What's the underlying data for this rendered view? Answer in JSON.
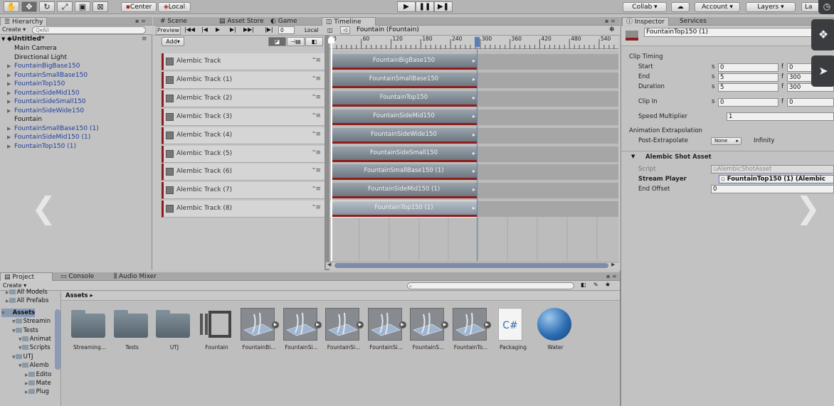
{
  "toolbar": {
    "tools": [
      "hand-tool-icon",
      "move-tool-icon",
      "rotate-tool-icon",
      "scale-tool-icon",
      "rect-tool-icon",
      "transform-tool-icon"
    ],
    "pivot_label": "Center",
    "space_label": "Local",
    "collab_label": "Collab ▾",
    "account_label": "Account",
    "layers_label": "Layers",
    "layout_label": "La"
  },
  "hierarchy": {
    "tab_label": "Hierarchy",
    "create_label": "Create ▾",
    "search_placeholder": "Q▾All",
    "scene_name": "Untitled*",
    "items": [
      {
        "label": "Main Camera",
        "prefab": false,
        "arrow": ""
      },
      {
        "label": "Directional Light",
        "prefab": false,
        "arrow": ""
      },
      {
        "label": "FountainBigBase150",
        "prefab": true,
        "arrow": "▶"
      },
      {
        "label": "FountainSmallBase150",
        "prefab": true,
        "arrow": "▶"
      },
      {
        "label": "FountainTop150",
        "prefab": true,
        "arrow": "▶"
      },
      {
        "label": "FountainSideMid150",
        "prefab": true,
        "arrow": "▶"
      },
      {
        "label": "FountainSideSmall150",
        "prefab": true,
        "arrow": "▶"
      },
      {
        "label": "FountainSideWide150",
        "prefab": true,
        "arrow": "▶"
      },
      {
        "label": "Fountain",
        "prefab": false,
        "arrow": ""
      },
      {
        "label": "FountainSmallBase150 (1)",
        "prefab": true,
        "arrow": "▶"
      },
      {
        "label": "FountainSideMid150 (1)",
        "prefab": true,
        "arrow": "▶"
      },
      {
        "label": "FountainTop150 (1)",
        "prefab": true,
        "arrow": "▶"
      }
    ]
  },
  "center_tabs": [
    "Scene",
    "Asset Store",
    "Game",
    "Timeline"
  ],
  "timeline": {
    "preview_label": "Preview",
    "frame_value": "0",
    "local_label": "Local",
    "title": "Fountain (Fountain)",
    "add_label": "Add▾",
    "ruler": [
      "0",
      "60",
      "120",
      "180",
      "240",
      "300",
      "360",
      "420",
      "480",
      "540"
    ],
    "tracks": [
      {
        "label": "Alembic Track",
        "clip": "FountainBigBase150"
      },
      {
        "label": "Alembic Track (1)",
        "clip": "FountainSmallBase150"
      },
      {
        "label": "Alembic Track (2)",
        "clip": "FountainTop150"
      },
      {
        "label": "Alembic Track (3)",
        "clip": "FountainSideMid150"
      },
      {
        "label": "Alembic Track (4)",
        "clip": "FountainSideWide150"
      },
      {
        "label": "Alembic Track (5)",
        "clip": "FountainSideSmall150"
      },
      {
        "label": "Alembic Track (6)",
        "clip": "FountainSmallBase150 (1)"
      },
      {
        "label": "Alembic Track (7)",
        "clip": "FountainSideMid150 (1)"
      },
      {
        "label": "Alembic Track (8)",
        "clip": "FountainTop150 (1)"
      }
    ]
  },
  "inspector": {
    "tab_label": "Inspector",
    "services_label": "Services",
    "object_name": "FountainTop150 (1)",
    "clip_timing_label": "Clip Timing",
    "rows": [
      {
        "label": "Start",
        "s": "0",
        "f": "0"
      },
      {
        "label": "End",
        "s": "5",
        "f": "300"
      },
      {
        "label": "Duration",
        "s": "5",
        "f": "300"
      },
      {
        "label": "Clip In",
        "s": "0",
        "f": "0"
      }
    ],
    "s_prefix": "s",
    "f_prefix": "f",
    "speed_label": "Speed Multiplier",
    "speed_value": "1",
    "extrap_label": "Animation Extrapolation",
    "post_label": "Post-Extrapolate",
    "post_value": "None",
    "post_extra": "Infinity",
    "component_label": "Alembic Shot Asset",
    "script_label": "Script",
    "script_value": "AlembicShotAsset",
    "stream_label": "Stream Player",
    "stream_value": "FountainTop150 (1) (Alembic",
    "end_offset_label": "End Offset",
    "end_offset_value": "0"
  },
  "project": {
    "tabs": [
      "Project",
      "Console",
      "Audio Mixer"
    ],
    "create_label": "Create ▾",
    "breadcrumb": "Assets ▸",
    "tree": [
      {
        "label": "All Models",
        "indent": 0
      },
      {
        "label": "All Prefabs",
        "indent": 0
      },
      {
        "label": "Assets",
        "indent": -1
      },
      {
        "label": "Streamin",
        "indent": 1
      },
      {
        "label": "Tests",
        "indent": 1
      },
      {
        "label": "Animat",
        "indent": 2
      },
      {
        "label": "Scripts",
        "indent": 2
      },
      {
        "label": "UTJ",
        "indent": 1
      },
      {
        "label": "Alemb",
        "indent": 2
      },
      {
        "label": "Edito",
        "indent": 3
      },
      {
        "label": "Mate",
        "indent": 3
      },
      {
        "label": "Plug",
        "indent": 3
      }
    ],
    "assets": [
      {
        "name": "Streaming...",
        "kind": "folder"
      },
      {
        "name": "Tests",
        "kind": "folder"
      },
      {
        "name": "UTJ",
        "kind": "folder"
      },
      {
        "name": "Fountain",
        "kind": "timeline"
      },
      {
        "name": "FountainBi...",
        "kind": "mesh"
      },
      {
        "name": "FountainSi...",
        "kind": "mesh"
      },
      {
        "name": "FountainSi...",
        "kind": "mesh"
      },
      {
        "name": "FountainSi...",
        "kind": "mesh"
      },
      {
        "name": "FountainS...",
        "kind": "mesh"
      },
      {
        "name": "FountainTo...",
        "kind": "mesh"
      },
      {
        "name": "Packaging",
        "kind": "script"
      },
      {
        "name": "Water",
        "kind": "sphere"
      }
    ],
    "script_glyph": "C#"
  }
}
